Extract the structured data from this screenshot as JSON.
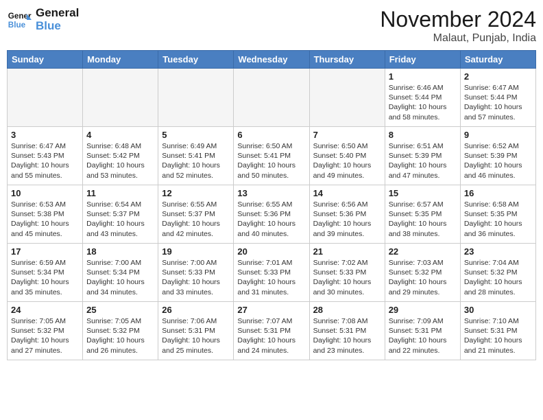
{
  "header": {
    "logo_line1": "General",
    "logo_line2": "Blue",
    "month": "November 2024",
    "location": "Malaut, Punjab, India"
  },
  "weekdays": [
    "Sunday",
    "Monday",
    "Tuesday",
    "Wednesday",
    "Thursday",
    "Friday",
    "Saturday"
  ],
  "weeks": [
    [
      {
        "day": "",
        "info": ""
      },
      {
        "day": "",
        "info": ""
      },
      {
        "day": "",
        "info": ""
      },
      {
        "day": "",
        "info": ""
      },
      {
        "day": "",
        "info": ""
      },
      {
        "day": "1",
        "info": "Sunrise: 6:46 AM\nSunset: 5:44 PM\nDaylight: 10 hours\nand 58 minutes."
      },
      {
        "day": "2",
        "info": "Sunrise: 6:47 AM\nSunset: 5:44 PM\nDaylight: 10 hours\nand 57 minutes."
      }
    ],
    [
      {
        "day": "3",
        "info": "Sunrise: 6:47 AM\nSunset: 5:43 PM\nDaylight: 10 hours\nand 55 minutes."
      },
      {
        "day": "4",
        "info": "Sunrise: 6:48 AM\nSunset: 5:42 PM\nDaylight: 10 hours\nand 53 minutes."
      },
      {
        "day": "5",
        "info": "Sunrise: 6:49 AM\nSunset: 5:41 PM\nDaylight: 10 hours\nand 52 minutes."
      },
      {
        "day": "6",
        "info": "Sunrise: 6:50 AM\nSunset: 5:41 PM\nDaylight: 10 hours\nand 50 minutes."
      },
      {
        "day": "7",
        "info": "Sunrise: 6:50 AM\nSunset: 5:40 PM\nDaylight: 10 hours\nand 49 minutes."
      },
      {
        "day": "8",
        "info": "Sunrise: 6:51 AM\nSunset: 5:39 PM\nDaylight: 10 hours\nand 47 minutes."
      },
      {
        "day": "9",
        "info": "Sunrise: 6:52 AM\nSunset: 5:39 PM\nDaylight: 10 hours\nand 46 minutes."
      }
    ],
    [
      {
        "day": "10",
        "info": "Sunrise: 6:53 AM\nSunset: 5:38 PM\nDaylight: 10 hours\nand 45 minutes."
      },
      {
        "day": "11",
        "info": "Sunrise: 6:54 AM\nSunset: 5:37 PM\nDaylight: 10 hours\nand 43 minutes."
      },
      {
        "day": "12",
        "info": "Sunrise: 6:55 AM\nSunset: 5:37 PM\nDaylight: 10 hours\nand 42 minutes."
      },
      {
        "day": "13",
        "info": "Sunrise: 6:55 AM\nSunset: 5:36 PM\nDaylight: 10 hours\nand 40 minutes."
      },
      {
        "day": "14",
        "info": "Sunrise: 6:56 AM\nSunset: 5:36 PM\nDaylight: 10 hours\nand 39 minutes."
      },
      {
        "day": "15",
        "info": "Sunrise: 6:57 AM\nSunset: 5:35 PM\nDaylight: 10 hours\nand 38 minutes."
      },
      {
        "day": "16",
        "info": "Sunrise: 6:58 AM\nSunset: 5:35 PM\nDaylight: 10 hours\nand 36 minutes."
      }
    ],
    [
      {
        "day": "17",
        "info": "Sunrise: 6:59 AM\nSunset: 5:34 PM\nDaylight: 10 hours\nand 35 minutes."
      },
      {
        "day": "18",
        "info": "Sunrise: 7:00 AM\nSunset: 5:34 PM\nDaylight: 10 hours\nand 34 minutes."
      },
      {
        "day": "19",
        "info": "Sunrise: 7:00 AM\nSunset: 5:33 PM\nDaylight: 10 hours\nand 33 minutes."
      },
      {
        "day": "20",
        "info": "Sunrise: 7:01 AM\nSunset: 5:33 PM\nDaylight: 10 hours\nand 31 minutes."
      },
      {
        "day": "21",
        "info": "Sunrise: 7:02 AM\nSunset: 5:33 PM\nDaylight: 10 hours\nand 30 minutes."
      },
      {
        "day": "22",
        "info": "Sunrise: 7:03 AM\nSunset: 5:32 PM\nDaylight: 10 hours\nand 29 minutes."
      },
      {
        "day": "23",
        "info": "Sunrise: 7:04 AM\nSunset: 5:32 PM\nDaylight: 10 hours\nand 28 minutes."
      }
    ],
    [
      {
        "day": "24",
        "info": "Sunrise: 7:05 AM\nSunset: 5:32 PM\nDaylight: 10 hours\nand 27 minutes."
      },
      {
        "day": "25",
        "info": "Sunrise: 7:05 AM\nSunset: 5:32 PM\nDaylight: 10 hours\nand 26 minutes."
      },
      {
        "day": "26",
        "info": "Sunrise: 7:06 AM\nSunset: 5:31 PM\nDaylight: 10 hours\nand 25 minutes."
      },
      {
        "day": "27",
        "info": "Sunrise: 7:07 AM\nSunset: 5:31 PM\nDaylight: 10 hours\nand 24 minutes."
      },
      {
        "day": "28",
        "info": "Sunrise: 7:08 AM\nSunset: 5:31 PM\nDaylight: 10 hours\nand 23 minutes."
      },
      {
        "day": "29",
        "info": "Sunrise: 7:09 AM\nSunset: 5:31 PM\nDaylight: 10 hours\nand 22 minutes."
      },
      {
        "day": "30",
        "info": "Sunrise: 7:10 AM\nSunset: 5:31 PM\nDaylight: 10 hours\nand 21 minutes."
      }
    ]
  ]
}
